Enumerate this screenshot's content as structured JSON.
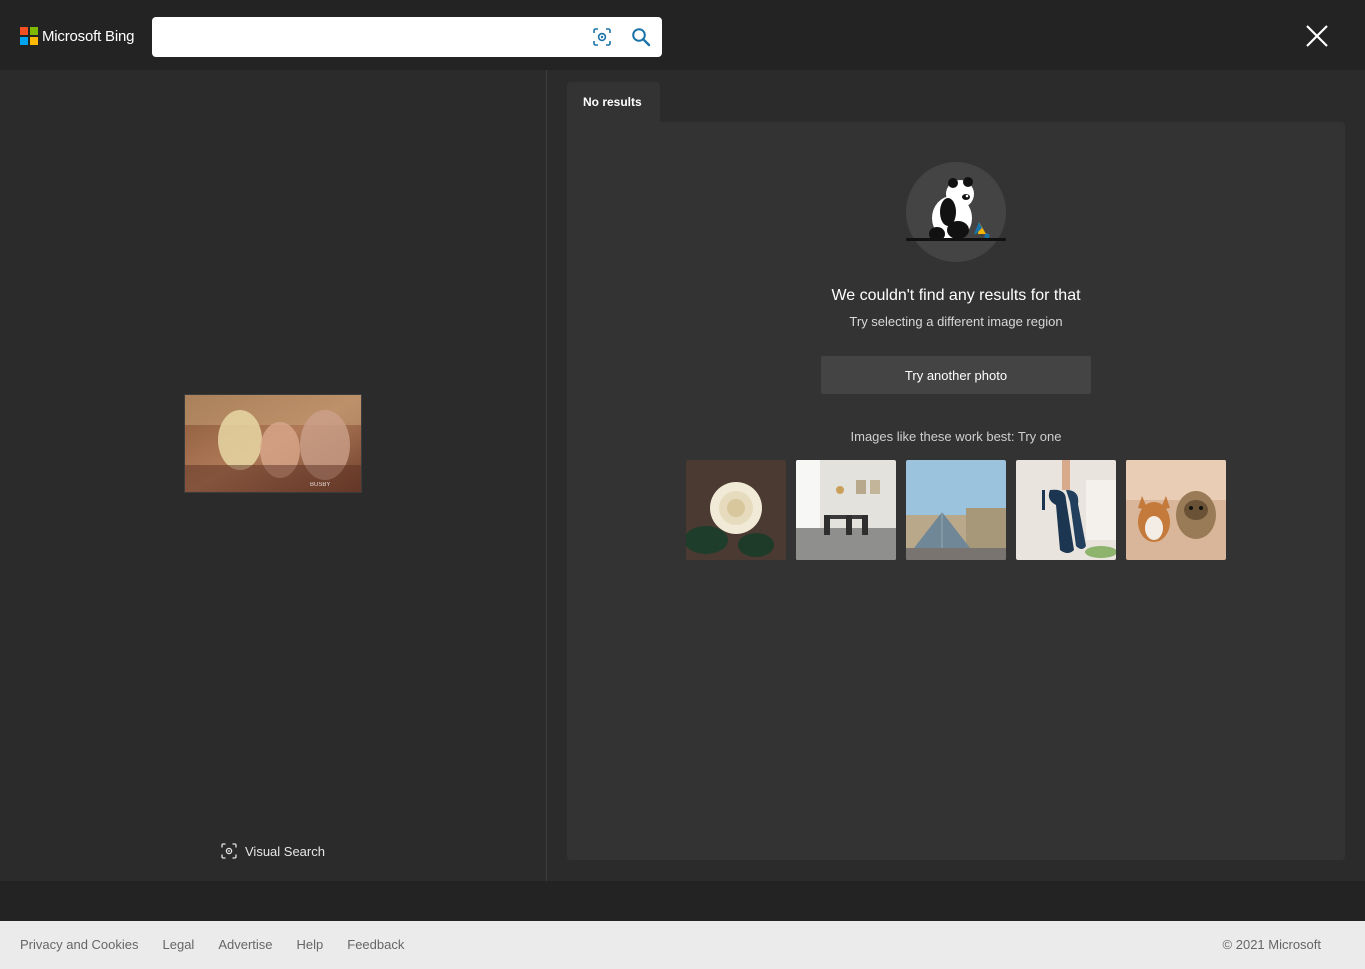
{
  "brand": {
    "name": "Microsoft Bing",
    "colors": [
      "#f25022",
      "#7fba00",
      "#00a4ef",
      "#ffb900"
    ]
  },
  "search": {
    "value": "",
    "placeholder": "",
    "visual_search_icon": "camera-scan-icon",
    "search_icon": "magnifier-icon"
  },
  "left_pane": {
    "visual_search_label": "Visual Search"
  },
  "results": {
    "tab_label": "No results",
    "title": "We couldn't find any results for that",
    "subtitle": "Try selecting a different image region",
    "button_label": "Try another photo",
    "hint": "Images like these work best: Try one",
    "examples": [
      "white-rose",
      "dining-room",
      "louvre-pyramid",
      "high-heels",
      "dogs"
    ]
  },
  "footer": {
    "links": [
      "Privacy and Cookies",
      "Legal",
      "Advertise",
      "Help",
      "Feedback"
    ],
    "copyright": "© 2021 Microsoft"
  }
}
